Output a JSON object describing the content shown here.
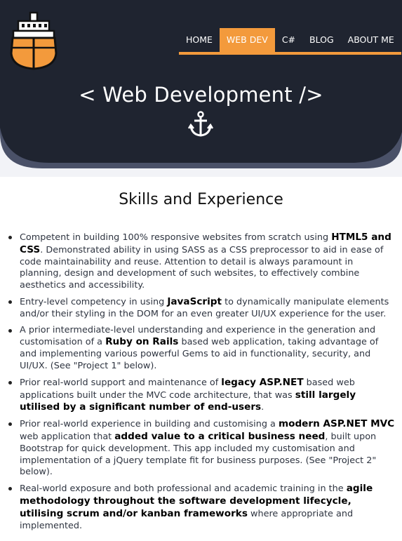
{
  "nav": {
    "items": [
      {
        "label": "HOME"
      },
      {
        "label": "WEB DEV"
      },
      {
        "label": "C#"
      },
      {
        "label": "BLOG"
      },
      {
        "label": "ABOUT ME"
      }
    ],
    "active_index": 1
  },
  "hero": {
    "title": "< Web Development />"
  },
  "icons": {
    "logo": "ship-icon",
    "hero": "anchor-icon"
  },
  "colors": {
    "header_dark": "#1f2430",
    "accent_orange": "#f39a3c",
    "page_bg": "#f2f3f7",
    "wave_shadow": "#4a5168"
  },
  "section": {
    "title": "Skills and Experience"
  },
  "skills": [
    {
      "parts": [
        {
          "t": "Competent in building 100% responsive websites from scratch using "
        },
        {
          "t": "HTML5 and CSS",
          "b": true
        },
        {
          "t": ". Demonstrated ability in using SASS as a CSS preprocessor to aid in ease of code maintainability and reuse. Attention to detail is always paramount in planning, design and development of such websites, to effectively combine aesthetics and accessibility."
        }
      ]
    },
    {
      "parts": [
        {
          "t": "Entry-level competency in using "
        },
        {
          "t": "JavaScript",
          "b": true
        },
        {
          "t": " to dynamically manipulate elements and/or their styling in the DOM for an even greater UI/UX experience for the user."
        }
      ]
    },
    {
      "parts": [
        {
          "t": "A prior intermediate-level understanding and experience in the generation and customisation of a "
        },
        {
          "t": "Ruby on Rails",
          "b": true
        },
        {
          "t": " based web application, taking advantage of and implementing various powerful Gems to aid in functionality, security, and UI/UX. (See \"Project 1\" below)."
        }
      ]
    },
    {
      "parts": [
        {
          "t": "Prior real-world support and maintenance of "
        },
        {
          "t": "legacy ASP.NET",
          "b": true
        },
        {
          "t": " based web applications built under the MVC code architecture, that was "
        },
        {
          "t": "still largely utilised by a significant number of end-users",
          "b": true
        },
        {
          "t": "."
        }
      ]
    },
    {
      "parts": [
        {
          "t": "Prior real-world experience in building and customising a "
        },
        {
          "t": "modern ASP.NET MVC",
          "b": true
        },
        {
          "t": " web application that "
        },
        {
          "t": "added value to a critical business need",
          "b": true
        },
        {
          "t": ", built upon Bootstrap for quick development. This app included my customisation and implementation of a jQuery template fit for business purposes. (See \"Project 2\" below)."
        }
      ]
    },
    {
      "parts": [
        {
          "t": "Real-world exposure and both professional and academic training in the "
        },
        {
          "t": "agile methodology throughout the software development lifecycle, utilising scrum and/or kanban frameworks",
          "b": true
        },
        {
          "t": " where appropriate and implemented."
        }
      ]
    }
  ]
}
